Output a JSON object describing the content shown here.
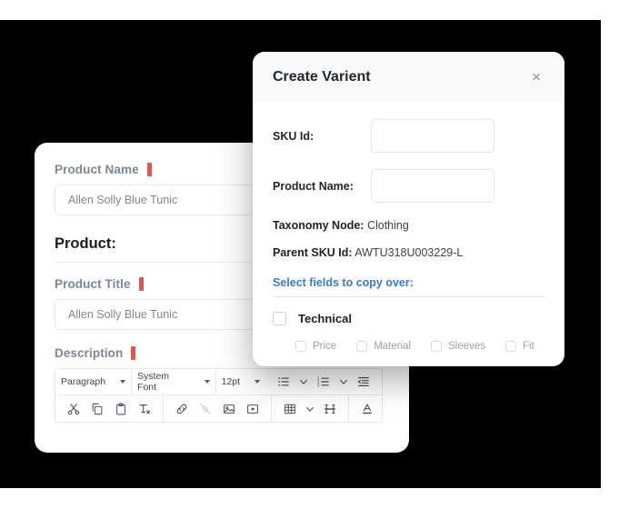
{
  "product_card": {
    "fields": [
      {
        "label": "Product Name",
        "required": true,
        "value": "Allen Solly Blue Tunic"
      }
    ],
    "section_heading": "Product:",
    "title_field": {
      "label": "Product Title",
      "required": true,
      "value": "Allen Solly Blue Tunic"
    },
    "description_label": "Description",
    "editor": {
      "block_format": "Paragraph",
      "font_family": "System Font",
      "font_size": "12pt",
      "row1_icons": [
        "unordered-list-icon",
        "chevron-down-icon",
        "ordered-list-icon",
        "chevron-down-icon",
        "outdent-icon"
      ],
      "row2_icons": [
        "cut-icon",
        "copy-icon",
        "paste-icon",
        "clear-formatting-icon",
        "link-icon",
        "unlink-icon",
        "image-icon",
        "video-icon",
        "table-icon",
        "chevron-down-icon",
        "horizontal-rule-icon",
        "text-color-icon",
        "chevron-down-icon"
      ]
    }
  },
  "modal": {
    "title": "Create Varient",
    "close_label": "×",
    "sku_id_label": "SKU Id:",
    "sku_id_value": "",
    "product_name_label": "Product Name:",
    "product_name_value": "",
    "taxonomy_key": "Taxonomy Node:",
    "taxonomy_value": " Clothing",
    "parent_sku_key": "Parent SKU Id:",
    "parent_sku_value": " AWTU318U003229-L",
    "copy_link": "Select fields to copy over:",
    "group_label": "Technical",
    "sub_fields": [
      "Price",
      "Material",
      "Sleeves",
      "Fit"
    ]
  },
  "colors": {
    "accent_required": "#e0564f",
    "link_blue": "#3a7bc0",
    "backdrop": "#000000",
    "header_bg": "#f8f9fa"
  }
}
